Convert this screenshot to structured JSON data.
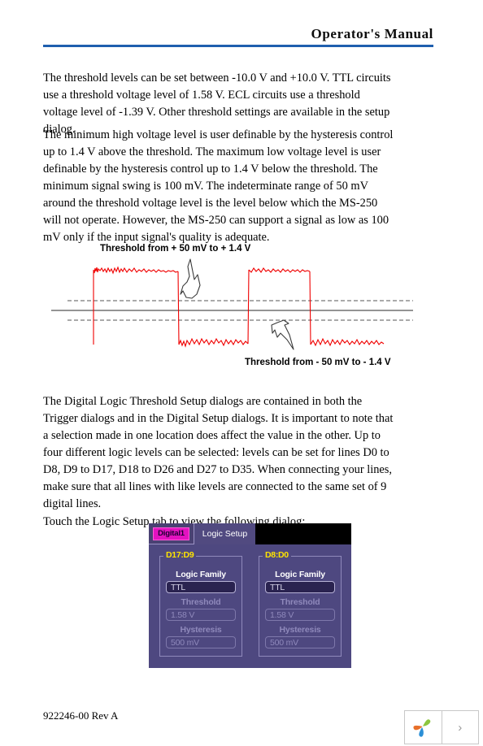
{
  "header": {
    "title": "Operator's Manual",
    "rule_color": "#1f5fae"
  },
  "paragraphs": {
    "p1": "The threshold levels can be set between -10.0 V and +10.0 V. TTL circuits use a threshold voltage level of 1.58 V. ECL circuits use a threshold voltage level of -1.39 V. Other threshold settings are available in the setup dialog.",
    "p2": "The minimum high voltage level is user definable by the hysteresis control up to 1.4 V above the threshold. The maximum low voltage level is user definable by the hysteresis control up to 1.4 V below the threshold. The minimum signal swing is 100 mV. The indeterminate range of 50 mV around the threshold voltage level is the level below which the MS-250 will not operate. However, the MS-250 can support a signal as low as 100 mV only if the input signal's quality is adequate.",
    "p3": "The Digital Logic Threshold Setup dialogs are contained in both the Trigger dialogs and in the Digital Setup dialogs. It is important to note that a selection made in one location does affect the value in the other. Up to four different logic levels can be selected: levels can be set for lines D0 to D8, D9 to D17, D18 to D26 and D27 to D35. When connecting your lines, make sure that all lines with like levels are connected to the same set of 9 digital lines.",
    "p4": "Touch the Logic Setup tab to view the following dialog:"
  },
  "figure": {
    "caption_top": "Threshold from + 50 mV to + 1.4 V",
    "caption_bottom": "Threshold from - 50 mV to - 1.4 V",
    "trace_color": "#f00000",
    "guide_color": "#555555"
  },
  "dialog": {
    "tabs": [
      {
        "label": "Digital1",
        "style": "chip",
        "active": false
      },
      {
        "label": "Logic Setup",
        "style": "plain",
        "active": true
      }
    ],
    "groups": [
      {
        "legend": "D17:D9",
        "fields": [
          {
            "label": "Logic Family",
            "value": "TTL",
            "enabled": true
          },
          {
            "label": "Threshold",
            "value": "1.58 V",
            "enabled": false
          },
          {
            "label": "Hysteresis",
            "value": "500 mV",
            "enabled": false
          }
        ]
      },
      {
        "legend": "D8:D0",
        "fields": [
          {
            "label": "Logic Family",
            "value": "TTL",
            "enabled": true
          },
          {
            "label": "Threshold",
            "value": "1.58 V",
            "enabled": false
          },
          {
            "label": "Hysteresis",
            "value": "500 mV",
            "enabled": false
          }
        ]
      }
    ],
    "colors": {
      "panel_bg": "#4e4880",
      "tab_active": "#514a80",
      "chip": "#e312c0",
      "legend_text": "#ffe400"
    }
  },
  "footer": {
    "doc_number": "922246-00 Rev A",
    "next_label": "›"
  }
}
